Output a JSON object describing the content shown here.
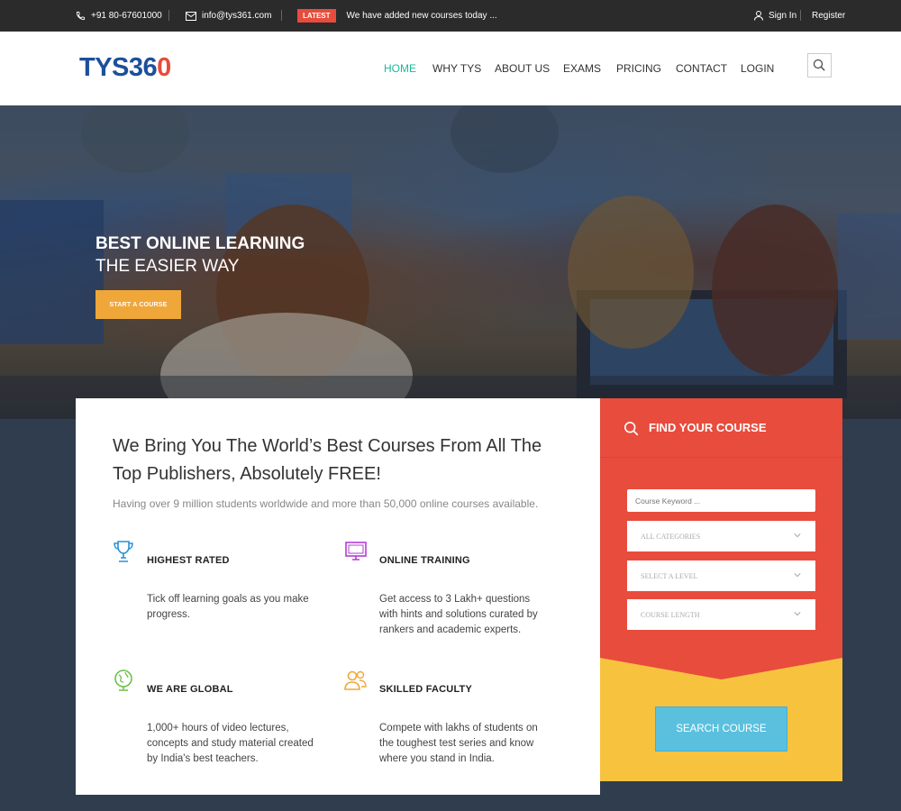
{
  "topbar": {
    "phone": "+91 80-67601000",
    "email": "info@tys361.com",
    "latest_badge": "LATEST",
    "latest_text": "We have added new courses today ...",
    "sign_in": "Sign In",
    "register": "Register"
  },
  "header": {
    "logo_main": "TYS36",
    "logo_accent": "0",
    "nav": [
      "HOME",
      "WHY TYS",
      "ABOUT US",
      "EXAMS",
      "PRICING",
      "CONTACT",
      "LOGIN"
    ],
    "active_nav": "HOME"
  },
  "hero": {
    "title": "BEST ONLINE LEARNING",
    "subtitle": "THE EASIER WAY",
    "button": "START A COURSE"
  },
  "intro": {
    "title": "We Bring You The World’s Best Courses From All The Top Publishers, Absolutely FREE!",
    "description": "Having over 9 million students worldwide and more than 50,000 online courses available."
  },
  "features": [
    {
      "icon": "trophy-icon",
      "title": "HIGHEST RATED",
      "text": "Tick off learning goals as you make progress."
    },
    {
      "icon": "monitor-icon",
      "title": "ONLINE TRAINING",
      "text": "Get access to 3 Lakh+ questions with hints and solutions curated by rankers and academic experts."
    },
    {
      "icon": "globe-icon",
      "title": "WE ARE GLOBAL",
      "text": "1,000+ hours of video lectures, concepts and study material created by India's best teachers."
    },
    {
      "icon": "users-icon",
      "title": "SKILLED FACULTY",
      "text": "Compete with lakhs of students on the toughest test series and know where you stand in India."
    }
  ],
  "finder": {
    "title": "FIND YOUR COURSE",
    "keyword_placeholder": "Course Keyword ...",
    "categories": "ALL CATEGORIES",
    "level": "SELECT A LEVEL",
    "length": "COURSE LENGTH",
    "button": "SEARCH COURSE"
  },
  "colors": {
    "accent_green": "#1bb99a",
    "brand_blue": "#1c4f9c",
    "finder_red": "#e84c3d",
    "finder_yellow": "#f7c33f",
    "hero_button": "#f0a73a",
    "search_button": "#5bc0de"
  }
}
